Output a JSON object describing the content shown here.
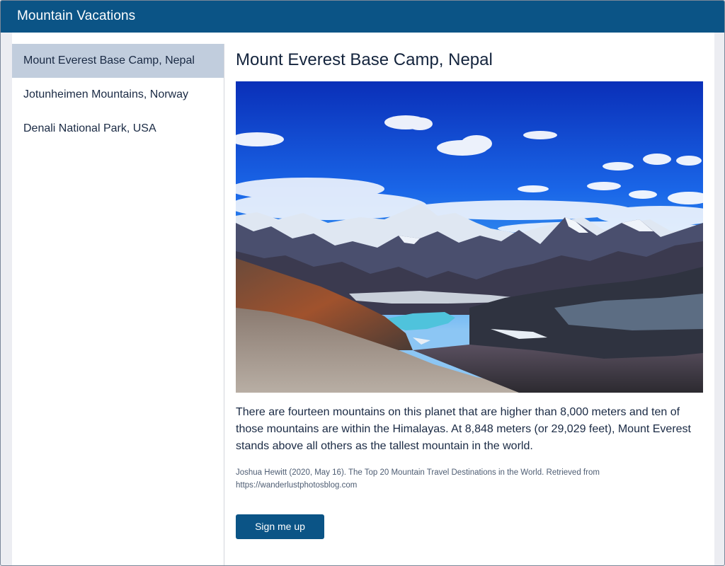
{
  "app": {
    "title": "Mountain Vacations"
  },
  "sidebar": {
    "items": [
      {
        "label": "Mount Everest Base Camp, Nepal",
        "active": true
      },
      {
        "label": "Jotunheimen Mountains, Norway",
        "active": false
      },
      {
        "label": "Denali National Park, USA",
        "active": false
      }
    ]
  },
  "main": {
    "title": "Mount Everest Base Camp, Nepal",
    "description": "There are fourteen mountains on this planet that are higher than 8,000 meters and ten of those mountains are within the Himalayas. At 8,848 meters (or 29,029 feet), Mount Everest stands above all others as the tallest mountain in the world.",
    "citation_line1": "Joshua Hewitt (2020, May 16). The Top 20 Mountain Travel Destinations in the World. Retrieved from",
    "citation_line2": "https://wanderlustphotosblog.com",
    "signup_label": "Sign me up"
  },
  "colors": {
    "brand": "#0b5486",
    "active_nav": "#c1cddd",
    "page_bg": "#ecedf2"
  }
}
